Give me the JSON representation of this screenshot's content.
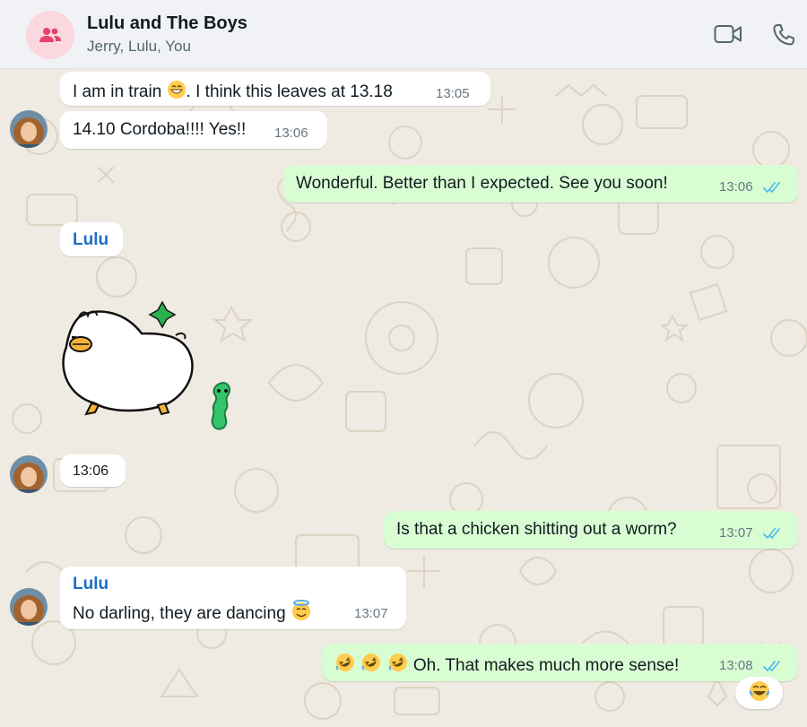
{
  "header": {
    "title": "Lulu and The Boys",
    "subtitle": "Jerry, Lulu, You"
  },
  "messages": [
    {
      "text": "I am in train",
      "text_after": ". I think this leaves at 13.18",
      "time": "13:05"
    },
    {
      "text": "14.10 Cordoba!!!! Yes!!",
      "time": "13:06"
    },
    {
      "text": "Wonderful. Better than I expected. See you soon!",
      "time": "13:06"
    },
    {
      "sender": "Lulu"
    },
    {
      "time": "13:06"
    },
    {
      "text": "Is that a chicken shitting out a worm?",
      "time": "13:07"
    },
    {
      "sender": "Lulu",
      "text": "No darling, they are dancing",
      "time": "13:07"
    },
    {
      "text": "Oh. That makes much more sense!",
      "time": "13:08"
    }
  ],
  "icons": {
    "group_avatar": "group-icon",
    "video": "video-camera-icon",
    "call": "phone-icon",
    "read": "double-check-icon"
  },
  "colors": {
    "header_bg": "#f0f2f5",
    "chat_bg": "#efeae2",
    "incoming_bubble": "#ffffff",
    "outgoing_bubble": "#d9fdd3",
    "sender_name": "#1b6fc4",
    "read_ticks": "#53bdeb",
    "group_avatar_bg": "#fbd7df",
    "group_avatar_icon": "#e5436c"
  }
}
